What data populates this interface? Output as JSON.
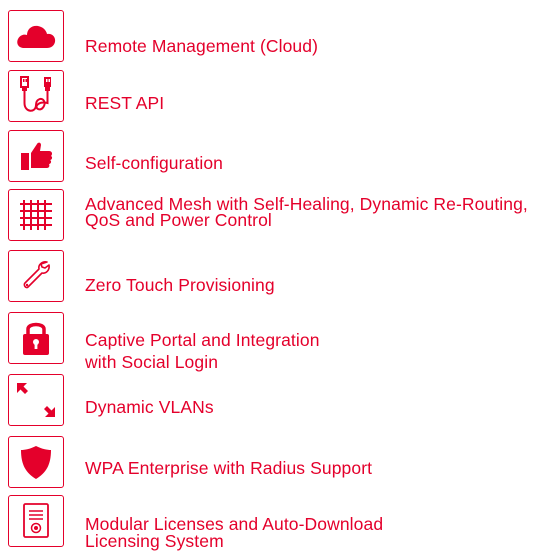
{
  "accent_color": "#e4002b",
  "features": [
    {
      "icon": "cloud-icon",
      "label": "Remote Management (Cloud)"
    },
    {
      "icon": "usb-cable-icon",
      "label": "REST API"
    },
    {
      "icon": "thumbs-up-icon",
      "label": "Self-configuration"
    },
    {
      "icon": "mesh-grid-icon",
      "label": "Advanced Mesh with Self-Healing, Dynamic Re-Routing,\nQoS and Power Control"
    },
    {
      "icon": "wrench-icon",
      "label": "Zero Touch Provisioning"
    },
    {
      "icon": "padlock-icon",
      "label": "Captive Portal and Integration\nwith Social Login"
    },
    {
      "icon": "diagonal-arrows-icon",
      "label": "Dynamic VLANs"
    },
    {
      "icon": "shield-icon",
      "label": "WPA Enterprise with Radius Support"
    },
    {
      "icon": "certificate-icon",
      "label": "Modular Licenses and Auto-Download\nLicensing System"
    }
  ]
}
